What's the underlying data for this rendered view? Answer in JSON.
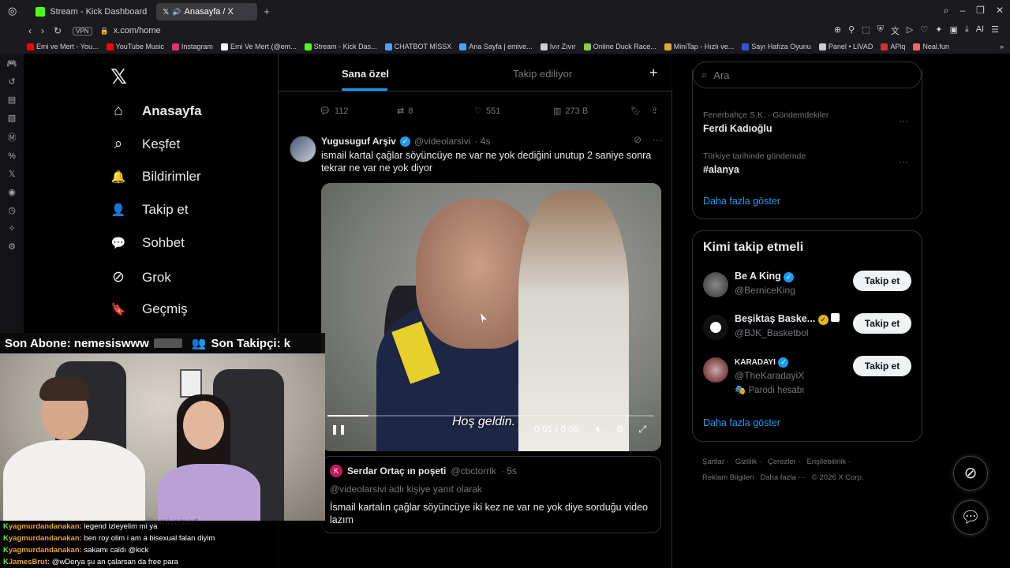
{
  "browser": {
    "tabs": [
      {
        "label": "Stream - Kick Dashboard",
        "color": "#53fc18"
      },
      {
        "label": "Anasayfa / X",
        "color": "#ffffff"
      }
    ],
    "new_tab": "+",
    "url": "x.com/home",
    "vpn": "VPN",
    "bookmarks": [
      {
        "label": "Emi ve Mert - You...",
        "color": "#ff0000"
      },
      {
        "label": "YouTube Music",
        "color": "#ff0000"
      },
      {
        "label": "Instagram",
        "color": "#e1306c"
      },
      {
        "label": "Emi Ve Mert (@em...",
        "color": "#ffffff"
      },
      {
        "label": "Stream - Kick Das...",
        "color": "#53fc18"
      },
      {
        "label": "CHATBOT MİSSX",
        "color": "#4aa3ff"
      },
      {
        "label": "Ana Sayfa | emive...",
        "color": "#4aa3ff"
      },
      {
        "label": "Ivır Zıvır",
        "color": "#cccccc"
      },
      {
        "label": "Online Duck Race...",
        "color": "#88cc44"
      },
      {
        "label": "MiniTap - Hızlı ve...",
        "color": "#ddaa33"
      },
      {
        "label": "Sayı Hafıza Oyunu",
        "color": "#3355dd"
      },
      {
        "label": "Panel • LIVAD",
        "color": "#cccccc"
      },
      {
        "label": "APiq",
        "color": "#cc3333"
      },
      {
        "label": "Neal.fun",
        "color": "#ff6666"
      }
    ]
  },
  "nav": {
    "logo": "𝕏",
    "items": [
      {
        "label": "Anasayfa",
        "icon": "⌂"
      },
      {
        "label": "Keşfet",
        "icon": "⌕"
      },
      {
        "label": "Bildirimler",
        "icon": "🔔"
      },
      {
        "label": "Takip et",
        "icon": "👤"
      },
      {
        "label": "Sohbet",
        "icon": "💬"
      },
      {
        "label": "Grok",
        "icon": "⊘"
      },
      {
        "label": "Geçmiş",
        "icon": "🔖"
      }
    ]
  },
  "feed": {
    "tabs": [
      "Sana özel",
      "Takip ediliyor"
    ],
    "plus": "+",
    "prev_actions": {
      "replies": "112",
      "reposts": "8",
      "likes": "551",
      "views": "273 B"
    },
    "tweet": {
      "name": "Yugusuguf Arşiv",
      "handle": "@videolarsivi",
      "time": "· 4s",
      "text": "ismail kartal çağlar söyüncüye ne var ne yok dediğini unutup 2 saniye sonra tekrar ne var ne yok diyor",
      "video": {
        "subtitle": "Hoş geldin.",
        "time": "0:01 / 0:08",
        "progress": 0.125
      },
      "quote": {
        "avatar": "K",
        "name": "Serdar Ortaç ın poşeti",
        "handle": "@cbctorrik",
        "time": "· 5s",
        "reply": "@videolarsivi adlı kişiye yanıt olarak",
        "text": "İsmail kartalın çağlar söyüncüye iki kez ne var ne yok diye sorduğu video lazım"
      }
    }
  },
  "right": {
    "search_placeholder": "Ara",
    "trends": [
      {
        "context": "Fenerbahçe S.K. · Gündemdekiler",
        "title": "Ferdi Kadıoğlu"
      },
      {
        "context": "Türkiye tarihinde gündemde",
        "title": "#alanya"
      }
    ],
    "show_more": "Daha fazla göster",
    "who_title": "Kimi takip etmeli",
    "who": [
      {
        "name": "Be A King",
        "handle": "@BerniceKing",
        "sub": "",
        "button": "Takip et",
        "color": "#444"
      },
      {
        "name": "Beşiktaş Baske...",
        "handle": "@BJK_Basketbol",
        "sub": "",
        "button": "Takip et",
        "color": "#111"
      },
      {
        "name": "KARADAYI",
        "handle": "@TheKaradayiX",
        "sub": "🎭 Parodi hesabı",
        "button": "Takip et",
        "color": "#7a2020"
      }
    ],
    "footer": [
      "Şartlar",
      "Gizlilik",
      "Çerezler",
      "Erişilebilirlik",
      "Reklam Bilgileri",
      "Daha fazla ···",
      "© 2026 X Corp."
    ]
  },
  "stream": {
    "alert": {
      "sub_label": "Son Abone:",
      "sub_name": "nemesiswww",
      "follow_label": "Son Takipçi:",
      "follow_name": "k"
    },
    "mention": "@emivemert",
    "chat": [
      {
        "user": "yagmurdandanakan:",
        "msg": "legend izleyelim mi ya"
      },
      {
        "user": "yagmurdandanakan:",
        "msg": "ben roy olim i am a bisexual falan diyim"
      },
      {
        "user": "yagmurdandanakan:",
        "msg": "sakamı caldı @kick"
      },
      {
        "user": "JamesBrut:",
        "msg": "@wDerya şu an çalarsan da free para"
      }
    ]
  }
}
